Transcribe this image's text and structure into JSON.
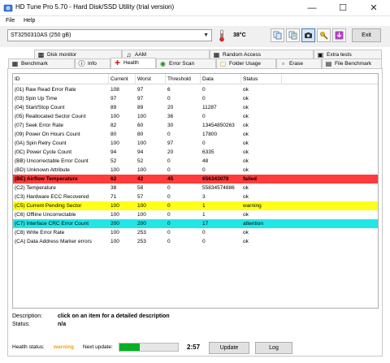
{
  "window": {
    "title": "HD Tune Pro 5.70 - Hard Disk/SSD Utility (trial version)"
  },
  "menu": [
    "File",
    "Help"
  ],
  "toolbar": {
    "drive": "ST3250310AS (250 gB)",
    "temperature": "38°C",
    "exit_label": "Exit",
    "buttons": [
      "copy-icon",
      "copy-all-icon",
      "screenshot-icon",
      "options-icon",
      "download-icon"
    ],
    "active_button": "screenshot-icon"
  },
  "tabs_top": [
    {
      "label": "Disk monitor",
      "icon": "disk-monitor-icon"
    },
    {
      "label": "AAM",
      "icon": "speaker-icon"
    },
    {
      "label": "Random Access",
      "icon": "random-access-icon"
    },
    {
      "label": "Extra tests",
      "icon": "extra-tests-icon"
    }
  ],
  "tabs_bottom": [
    {
      "label": "Benchmark",
      "icon": "benchmark-icon"
    },
    {
      "label": "Info",
      "icon": "info-icon"
    },
    {
      "label": "Health",
      "icon": "health-cross-icon"
    },
    {
      "label": "Error Scan",
      "icon": "error-scan-icon"
    },
    {
      "label": "Folder Usage",
      "icon": "folder-icon"
    },
    {
      "label": "Erase",
      "icon": "erase-icon"
    },
    {
      "label": "File Benchmark",
      "icon": "file-benchmark-icon"
    }
  ],
  "active_tab": "Health",
  "table": {
    "columns": [
      "ID",
      "Current",
      "Worst",
      "Threshold",
      "Data",
      "Status"
    ],
    "rows": [
      {
        "id": "(01) Raw Read Error Rate",
        "current": "108",
        "worst": "97",
        "threshold": "6",
        "data": "0",
        "status": "ok"
      },
      {
        "id": "(03) Spin Up Time",
        "current": "97",
        "worst": "97",
        "threshold": "0",
        "data": "0",
        "status": "ok"
      },
      {
        "id": "(04) Start/Stop Count",
        "current": "89",
        "worst": "89",
        "threshold": "20",
        "data": "11287",
        "status": "ok"
      },
      {
        "id": "(05) Reallocated Sector Count",
        "current": "100",
        "worst": "100",
        "threshold": "36",
        "data": "0",
        "status": "ok"
      },
      {
        "id": "(07) Seek Error Rate",
        "current": "82",
        "worst": "60",
        "threshold": "30",
        "data": "13454850263",
        "status": "ok"
      },
      {
        "id": "(09) Power On Hours Count",
        "current": "80",
        "worst": "80",
        "threshold": "0",
        "data": "17800",
        "status": "ok"
      },
      {
        "id": "(0A) Spin Retry Count",
        "current": "100",
        "worst": "100",
        "threshold": "97",
        "data": "0",
        "status": "ok"
      },
      {
        "id": "(0C) Power Cycle Count",
        "current": "94",
        "worst": "94",
        "threshold": "20",
        "data": "6335",
        "status": "ok"
      },
      {
        "id": "(BB) Uncorrectable Error Count",
        "current": "52",
        "worst": "52",
        "threshold": "0",
        "data": "48",
        "status": "ok"
      },
      {
        "id": "(BD) Unknown Attribute",
        "current": "100",
        "worst": "100",
        "threshold": "0",
        "data": "0",
        "status": "ok"
      },
      {
        "id": "(BE) Airflow Temperature",
        "current": "62",
        "worst": "42",
        "threshold": "45",
        "data": "656343078",
        "status": "failed",
        "highlight": "#ff3b3b",
        "bold": true
      },
      {
        "id": "(C2) Temperature",
        "current": "38",
        "worst": "58",
        "threshold": "0",
        "data": "55834574886",
        "status": "ok"
      },
      {
        "id": "(C3) Hardware ECC Recovered",
        "current": "71",
        "worst": "57",
        "threshold": "0",
        "data": "3",
        "status": "ok"
      },
      {
        "id": "(C5) Current Pending Sector",
        "current": "100",
        "worst": "100",
        "threshold": "0",
        "data": "1",
        "status": "warning",
        "highlight": "#ffff1a"
      },
      {
        "id": "(C6) Offline Uncorrectable",
        "current": "100",
        "worst": "100",
        "threshold": "0",
        "data": "1",
        "status": "ok"
      },
      {
        "id": "(C7) Interface CRC Error Count",
        "current": "200",
        "worst": "200",
        "threshold": "0",
        "data": "17",
        "status": "attention",
        "highlight": "#22e6e6"
      },
      {
        "id": "(C8) Write Error Rate",
        "current": "100",
        "worst": "253",
        "threshold": "0",
        "data": "0",
        "status": "ok"
      },
      {
        "id": "(CA) Data Address Marker errors",
        "current": "100",
        "worst": "253",
        "threshold": "0",
        "data": "0",
        "status": "ok"
      }
    ]
  },
  "description": {
    "description_label": "Description:",
    "description_value": "click on an item for a detailed description",
    "status_label": "Status:",
    "status_value": "n/a"
  },
  "statusbar": {
    "health_label": "Health status:",
    "health_value": "warning",
    "next_update_label": "Next update:",
    "progress": 0.35,
    "time": "2:57",
    "update_label": "Update",
    "log_label": "Log",
    "health_color": "#ff9900",
    "progress_color": "#06b025"
  }
}
